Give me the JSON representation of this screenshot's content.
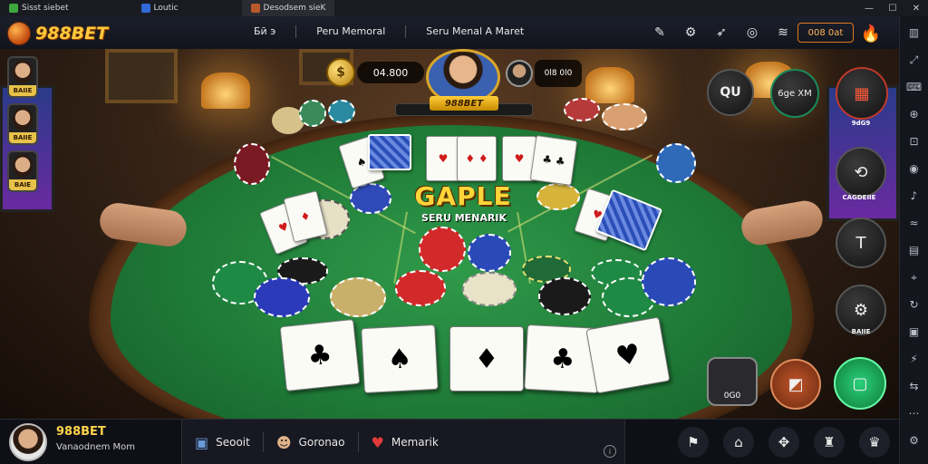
{
  "window": {
    "tabs": [
      {
        "label": "Sisst siebet",
        "icon": "app-icon"
      },
      {
        "label": "Loutic",
        "icon": "window-icon"
      },
      {
        "label": "Desodsem sieK",
        "icon": "game-icon"
      }
    ],
    "controls": [
      "—",
      "☐",
      "✕"
    ]
  },
  "header": {
    "brand": "988BET",
    "nav": [
      "Бӣ э",
      "Peru Memoral",
      "Seru Menal A Maret"
    ],
    "badge": "008 0at"
  },
  "scene": {
    "coins_value": "04.800",
    "hero_label": "988BET",
    "opponent_info": "0l8 0l0",
    "title": "GAPLE",
    "subtitle": "SERU MENARIK",
    "side_players": [
      "BAIIE",
      "BAIIE",
      "BAIE"
    ],
    "right_buttons": [
      {
        "text": "QU",
        "label": ""
      },
      {
        "text": "6ge\nXM",
        "label": ""
      },
      {
        "text": "▦",
        "label": "9dG9"
      },
      {
        "text": "⟲",
        "label": "CAGDEIIE"
      },
      {
        "text": "T",
        "label": ""
      },
      {
        "text": "⚙",
        "label": "BAIIE"
      }
    ],
    "rank_badge": "0G0"
  },
  "bottom": {
    "player_name": "988BET",
    "player_sub": "Vanaodnem Mom",
    "items": [
      {
        "label": "Seooit",
        "icon": "chest-icon"
      },
      {
        "label": "Goronao",
        "icon": "player-icon"
      },
      {
        "label": "Memarik",
        "icon": "heart-icon"
      }
    ]
  },
  "colors": {
    "felt": "#1f7a37",
    "gold": "#ffd53a",
    "accent_orange": "#e07a1a"
  }
}
